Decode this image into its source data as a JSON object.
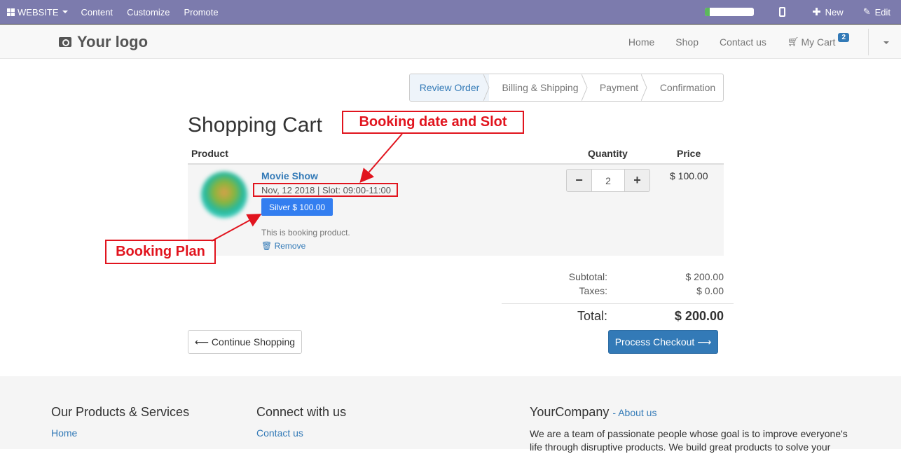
{
  "adminbar": {
    "website": "WEBSITE",
    "content": "Content",
    "customize": "Customize",
    "promote": "Promote",
    "new": "New",
    "edit": "Edit",
    "progress": 0.1
  },
  "navbar": {
    "logo": "Your logo",
    "links": [
      "Home",
      "Shop",
      "Contact us"
    ],
    "cart_label": "My Cart",
    "cart_count": "2"
  },
  "wizard": {
    "steps": [
      "Review Order",
      "Billing & Shipping",
      "Payment",
      "Confirmation"
    ],
    "active": "Review Order"
  },
  "cart": {
    "title": "Shopping Cart",
    "headers": {
      "product": "Product",
      "quantity": "Quantity",
      "price": "Price"
    },
    "item": {
      "name": "Movie Show",
      "booking": "Nov, 12 2018 | Slot: 09:00-11:00",
      "plan": "Silver $ 100.00",
      "description": "This is booking product.",
      "remove": "Remove",
      "quantity": "2",
      "price": "$ 100.00",
      "minus": "−",
      "plus": "+"
    },
    "subtotal_label": "Subtotal:",
    "subtotal": "$ 200.00",
    "taxes_label": "Taxes:",
    "taxes": "$ 0.00",
    "total_label": "Total:",
    "total": "$ 200.00",
    "continue": "⟵ Continue Shopping",
    "checkout": "Process Checkout ⟶"
  },
  "annotations": {
    "booking_date": "Booking date and Slot",
    "booking_plan": "Booking Plan",
    "color": "#e1141e"
  },
  "footer": {
    "col1_title": "Our Products & Services",
    "col1_link": "Home",
    "col2_title": "Connect with us",
    "col2_link": "Contact us",
    "col3_title": "YourCompany",
    "col3_about": "- About us",
    "col3_text": "We are a team of passionate people whose goal is to improve everyone's life through disruptive products. We build great products to solve your"
  }
}
